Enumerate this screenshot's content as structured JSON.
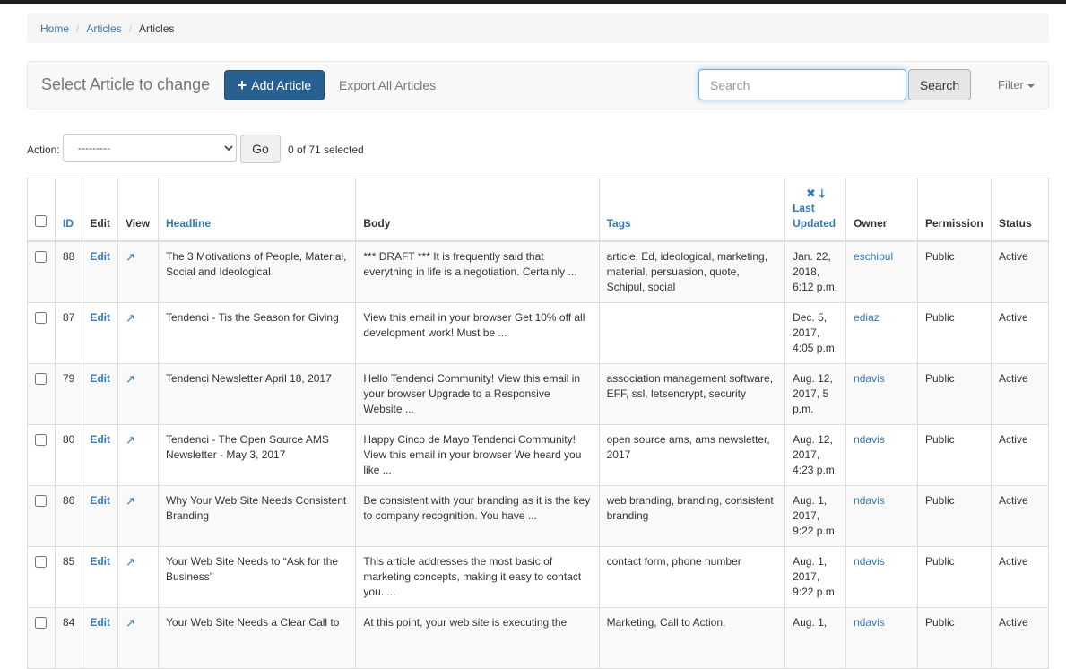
{
  "breadcrumb": {
    "home": "Home",
    "articles": "Articles",
    "current": "Articles"
  },
  "toolbar": {
    "title": "Select Article to change",
    "add_label": "Add Article",
    "export_label": "Export All Articles",
    "search_placeholder": "Search",
    "search_button": "Search",
    "filter_label": "Filter"
  },
  "actions": {
    "label": "Action:",
    "selected_option": "---------",
    "go_label": "Go",
    "count_text": "0 of 71 selected"
  },
  "table": {
    "headers": {
      "id": "ID",
      "edit": "Edit",
      "view": "View",
      "headline": "Headline",
      "body": "Body",
      "tags": "Tags",
      "updated": "Last Updated",
      "owner": "Owner",
      "permission": "Permission",
      "status": "Status"
    },
    "sort_icons": "✖ 🡓",
    "rows": [
      {
        "id": "88",
        "edit": "Edit",
        "headline": "The 3 Motivations of People, Material, Social and Ideological",
        "body": "*** DRAFT *** It is frequently said that everything in life is a negotiation. Certainly ...",
        "tags": "article, Ed, ideological, marketing, material, persuasion, quote, Schipul, social",
        "updated": "Jan. 22, 2018, 6:12 p.m.",
        "owner": "eschipul",
        "permission": "Public",
        "status": "Active"
      },
      {
        "id": "87",
        "edit": "Edit",
        "headline": "Tendenci - Tis the Season for Giving",
        "body": "  View this email in your browser Get 10% off all development work! Must be ...",
        "tags": "",
        "updated": "Dec. 5, 2017, 4:05 p.m.",
        "owner": "ediaz",
        "permission": "Public",
        "status": "Active"
      },
      {
        "id": "79",
        "edit": "Edit",
        "headline": "Tendenci Newsletter April 18, 2017",
        "body": "  Hello Tendenci Community! View this email in your browser Upgrade to a Responsive Website ...",
        "tags": "association management software, EFF, ssl, letsencrypt, security",
        "updated": "Aug. 12, 2017, 5 p.m.",
        "owner": "ndavis",
        "permission": "Public",
        "status": "Active"
      },
      {
        "id": "80",
        "edit": "Edit",
        "headline": "Tendenci - The Open Source AMS Newsletter - May 3, 2017",
        "body": "Happy Cinco de Mayo Tendenci Community! View this email in your browser We heard you like ...",
        "tags": "open source ams, ams newsletter, 2017",
        "updated": "Aug. 12, 2017, 4:23 p.m.",
        "owner": "ndavis",
        "permission": "Public",
        "status": "Active"
      },
      {
        "id": "86",
        "edit": "Edit",
        "headline": "Why Your Web Site Needs Consistent Branding",
        "body": "Be consistent with your branding as it is the key to company recognition.  You have ...",
        "tags": "web branding, branding, consistent branding",
        "updated": "Aug. 1, 2017, 9:22 p.m.",
        "owner": "ndavis",
        "permission": "Public",
        "status": "Active"
      },
      {
        "id": "85",
        "edit": "Edit",
        "headline": "Your Web Site Needs to “Ask for the Business”",
        "body": "This article addresses the most basic of marketing concepts, making it easy to contact you. ...",
        "tags": "contact form, phone number",
        "updated": "Aug. 1, 2017, 9:22 p.m.",
        "owner": "ndavis",
        "permission": "Public",
        "status": "Active"
      },
      {
        "id": "84",
        "edit": "Edit",
        "headline": "Your Web Site Needs a Clear Call to",
        "body": "At this point, your web site is executing the",
        "tags": "Marketing, Call to Action,",
        "updated": "Aug. 1,",
        "owner": "ndavis",
        "permission": "Public",
        "status": "Active"
      }
    ]
  }
}
